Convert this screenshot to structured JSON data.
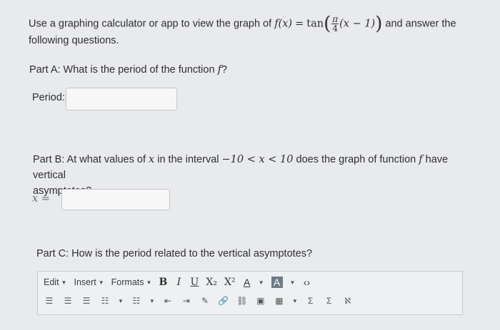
{
  "question": {
    "intro_before": "Use a graphing calculator or app to view the graph of",
    "intro_fx": "f(x)",
    "intro_eq": "=",
    "intro_tan": "tan",
    "intro_pi": "π",
    "intro_four": "4",
    "intro_inner": "(x − 1)",
    "intro_after": "and answer the",
    "intro_line2": "following questions."
  },
  "partA": {
    "text": "Part A: What is the period of the function",
    "var": "f",
    "qmark": "?",
    "period_label": "Period:",
    "period_value": ""
  },
  "partB": {
    "text1": "Part B: At what values of",
    "var_x": "x",
    "text2": "in the interval",
    "interval": "−10 < x < 10",
    "text3": "does the graph of function",
    "var_f": "f",
    "text4": "have vertical",
    "line2": "asymptotes?",
    "x_label": "x =",
    "x_value": ""
  },
  "partC": {
    "text": "Part C: How is the period related to the vertical asymptotes?"
  },
  "editor": {
    "menus": [
      "Edit",
      "Insert",
      "Formats"
    ],
    "format_buttons": [
      "B",
      "I",
      "U",
      "X₂",
      "X²",
      "A",
      "A",
      "‹›"
    ],
    "row2_icons": [
      "align-left-icon",
      "align-center-icon",
      "align-right-icon",
      "bullet-list-icon",
      "numbered-list-icon",
      "outdent-icon",
      "indent-icon",
      "paint-icon",
      "link-icon",
      "unlink-icon",
      "image-icon",
      "table-icon",
      "sigma-icon",
      "sum-icon",
      "ab-icon"
    ]
  }
}
